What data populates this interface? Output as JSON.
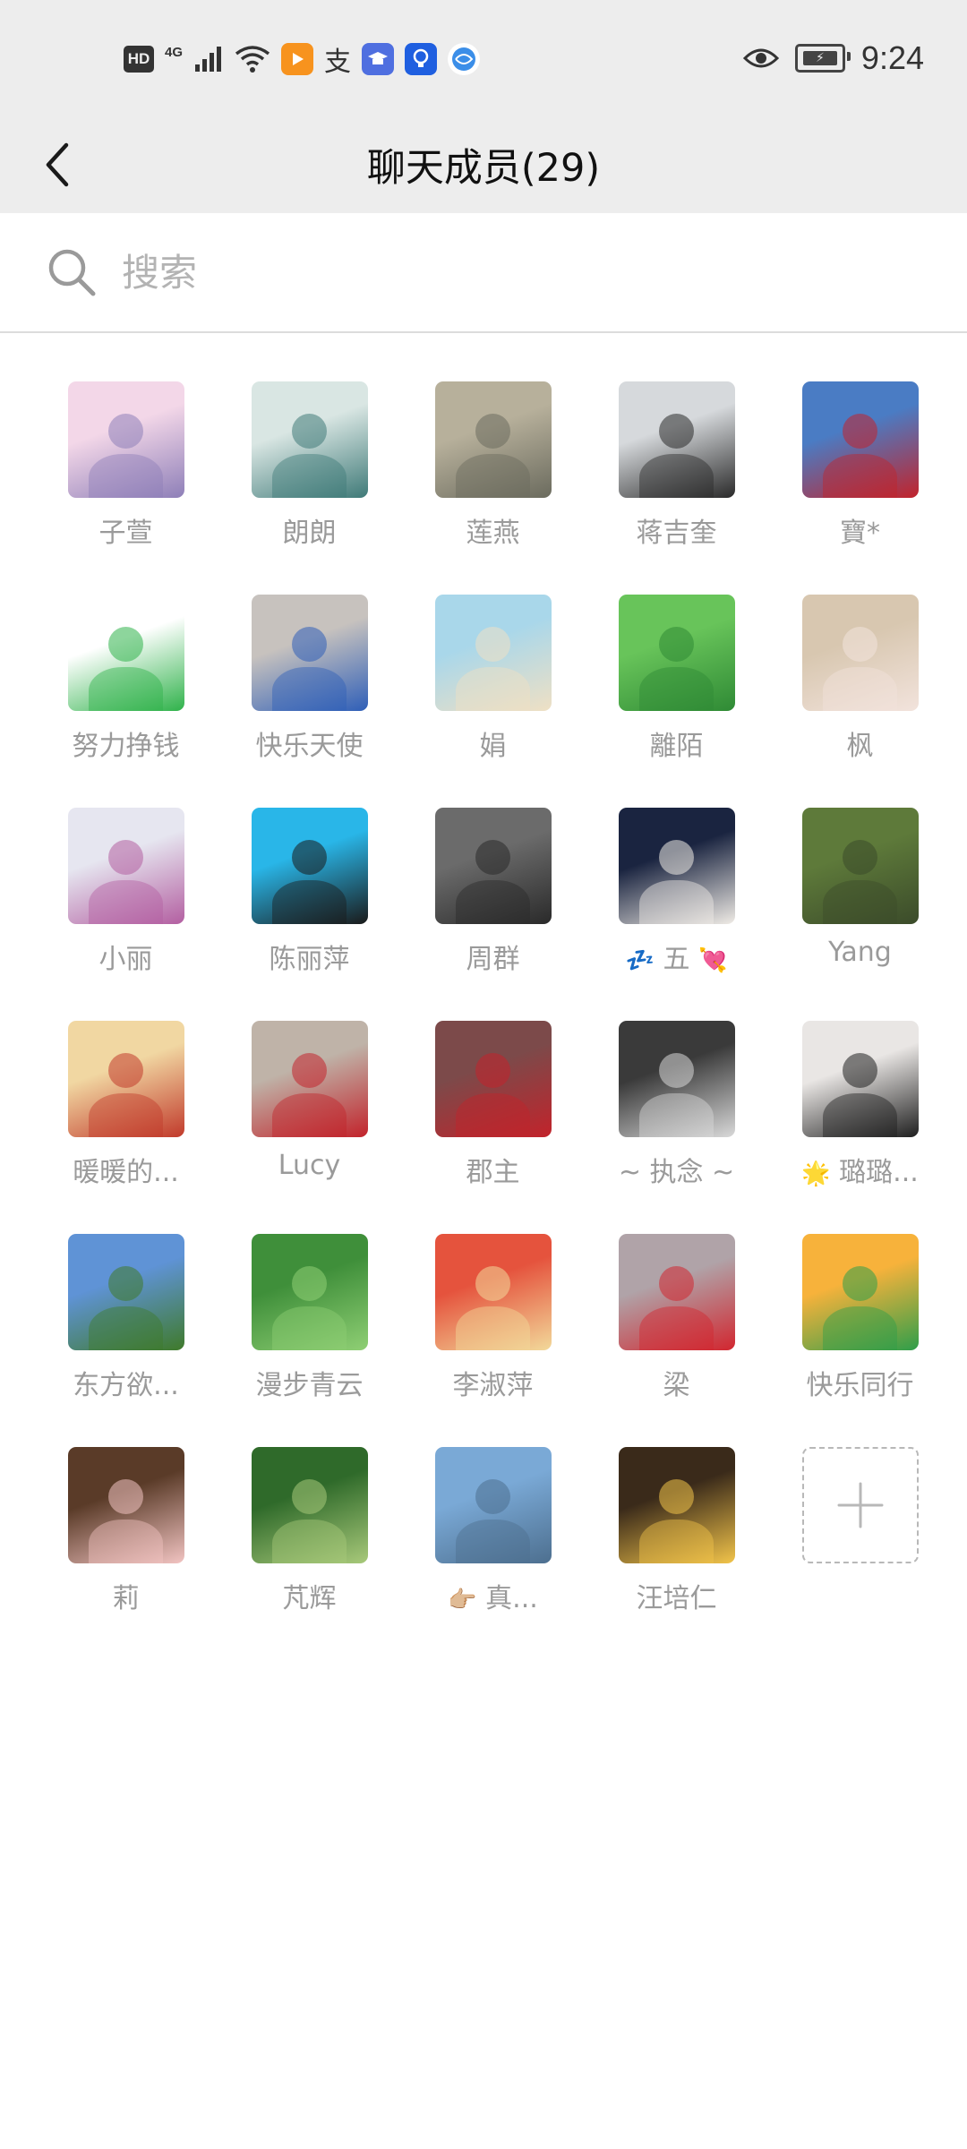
{
  "status_bar": {
    "hd": "HD",
    "network": "4G",
    "alipay_glyph": "支",
    "time": "9:24"
  },
  "nav": {
    "title": "聊天成员(29)"
  },
  "search": {
    "placeholder": "搜索"
  },
  "members": [
    {
      "name": "子萱",
      "avatar": "cartoon-girl-avatar",
      "colors": [
        "#f3d7e8",
        "#8e7fb8"
      ]
    },
    {
      "name": "朗朗",
      "avatar": "sea-sunrise-avatar",
      "colors": [
        "#d9e6e3",
        "#3f7a78"
      ]
    },
    {
      "name": "莲燕",
      "avatar": "statue-photo-avatar",
      "colors": [
        "#b7b09b",
        "#6b6b5e"
      ]
    },
    {
      "name": "蒋吉奎",
      "avatar": "man-portrait-avatar",
      "colors": [
        "#d6d9dc",
        "#2a2a2a"
      ]
    },
    {
      "name": "寶*",
      "avatar": "hot-air-balloon-avatar",
      "colors": [
        "#4a7cc4",
        "#c2232b"
      ]
    },
    {
      "name": "努力挣钱",
      "avatar": "green-logo-avatar",
      "colors": [
        "#ffffff",
        "#2fb24a"
      ]
    },
    {
      "name": "快乐天使",
      "avatar": "woman-portrait-avatar",
      "colors": [
        "#c7c2be",
        "#2f5fb8"
      ]
    },
    {
      "name": "娟",
      "avatar": "toy-figure-avatar",
      "colors": [
        "#a9d7ea",
        "#efe0c4"
      ]
    },
    {
      "name": "離陌",
      "avatar": "green-leaf-avatar",
      "colors": [
        "#68c45a",
        "#2f8a35"
      ]
    },
    {
      "name": "枫",
      "avatar": "girl-selfie-avatar",
      "colors": [
        "#d8c7b0",
        "#f2e3dc"
      ]
    },
    {
      "name": "小丽",
      "avatar": "flower-vase-avatar",
      "colors": [
        "#e6e6f0",
        "#b35fa1"
      ]
    },
    {
      "name": "陈丽萍",
      "avatar": "woman-id-photo-avatar",
      "colors": [
        "#29b6e8",
        "#1a1a1a"
      ]
    },
    {
      "name": "周群",
      "avatar": "man-suit-avatar",
      "colors": [
        "#6b6b6b",
        "#2a2a2a"
      ]
    },
    {
      "name": "五",
      "avatar": "white-cat-avatar",
      "colors": [
        "#1a2440",
        "#f0ece6"
      ],
      "prefix": "💤",
      "suffix": "💘"
    },
    {
      "name": "Yang",
      "avatar": "garden-avatar",
      "colors": [
        "#5e7a3a",
        "#3b4b2a"
      ]
    },
    {
      "name": "暖暖的...",
      "avatar": "illustration-avatar",
      "colors": [
        "#f1d7a2",
        "#c13a2b"
      ]
    },
    {
      "name": "Lucy",
      "avatar": "woman-red-avatar",
      "colors": [
        "#bfb3a8",
        "#c2232b"
      ]
    },
    {
      "name": "郡主",
      "avatar": "woman-glasses-avatar",
      "colors": [
        "#7c4a4a",
        "#c2232b"
      ]
    },
    {
      "name": "~ 执念 ~",
      "avatar": "honey-badger-avatar",
      "colors": [
        "#3a3a3a",
        "#d9d9d9"
      ]
    },
    {
      "name": "璐璐...",
      "avatar": "woman-cat-ears-avatar",
      "colors": [
        "#e9e6e4",
        "#1f1f1f"
      ],
      "prefix": "🌟"
    },
    {
      "name": "东方欲...",
      "avatar": "mountain-lake-avatar",
      "colors": [
        "#5f93d6",
        "#3f7a2a"
      ]
    },
    {
      "name": "漫步青云",
      "avatar": "green-plant-avatar",
      "colors": [
        "#3f8f3a",
        "#8fcf74"
      ]
    },
    {
      "name": "李淑萍",
      "avatar": "grapefruit-avatar",
      "colors": [
        "#e5533d",
        "#f2d99a"
      ]
    },
    {
      "name": "梁",
      "avatar": "family-photo-avatar",
      "colors": [
        "#b0a3a8",
        "#d2262f"
      ]
    },
    {
      "name": "快乐同行",
      "avatar": "greeting-card-avatar",
      "colors": [
        "#f7b23b",
        "#2f9e4a"
      ]
    },
    {
      "name": "莉",
      "avatar": "piglets-avatar",
      "colors": [
        "#5a3b28",
        "#f2c4c2"
      ]
    },
    {
      "name": "芃辉",
      "avatar": "tree-avatar",
      "colors": [
        "#2f6a2a",
        "#a8c97a"
      ]
    },
    {
      "name": "真...",
      "avatar": "waterfront-avatar",
      "colors": [
        "#7aa9d6",
        "#4d6f8f"
      ],
      "prefix": "👉🏼"
    },
    {
      "name": "汪培仁",
      "avatar": "chandelier-avatar",
      "colors": [
        "#3a2a1a",
        "#f2c44a"
      ]
    }
  ],
  "add_button": {
    "icon": "plus-icon"
  }
}
